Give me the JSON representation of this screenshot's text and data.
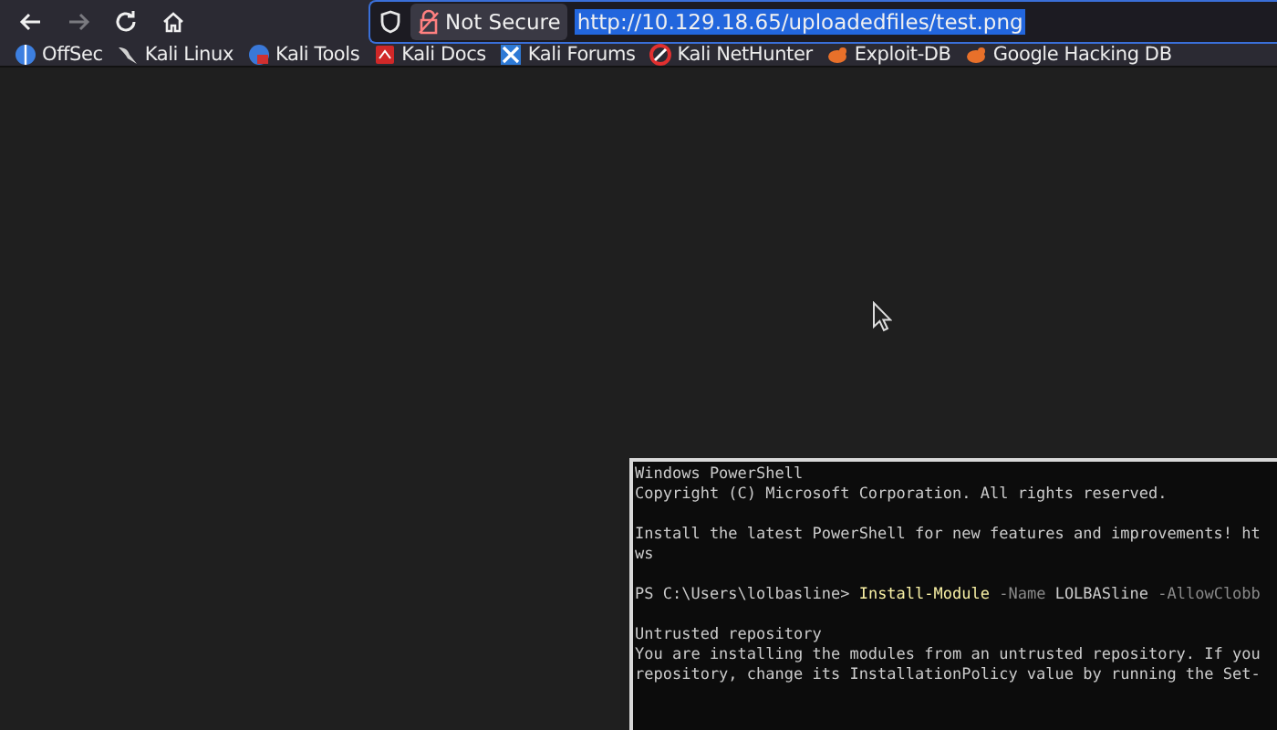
{
  "toolbar": {
    "nav_buttons": [
      {
        "kind": "back",
        "disabled": false
      },
      {
        "kind": "forward",
        "disabled": true
      },
      {
        "kind": "reload",
        "disabled": false
      },
      {
        "kind": "home",
        "disabled": false
      }
    ],
    "address_bar": {
      "security_label": "Not Secure",
      "url": "http://10.129.18.65/uploadedfiles/test.png",
      "selected": true
    }
  },
  "bookmarks": [
    {
      "label": "OffSec"
    },
    {
      "label": "Kali Linux"
    },
    {
      "label": "Kali Tools"
    },
    {
      "label": "Kali Docs"
    },
    {
      "label": "Kali Forums"
    },
    {
      "label": "Kali NetHunter"
    },
    {
      "label": "Exploit-DB"
    },
    {
      "label": "Google Hacking DB"
    }
  ],
  "terminal": {
    "lines": [
      {
        "kind": "text",
        "segments": [
          {
            "kind": "plain",
            "text": "Windows PowerShell"
          }
        ]
      },
      {
        "kind": "text",
        "segments": [
          {
            "kind": "plain",
            "text": "Copyright (C) Microsoft Corporation. All rights reserved."
          }
        ]
      },
      {
        "kind": "blank"
      },
      {
        "kind": "text",
        "segments": [
          {
            "kind": "plain",
            "text": "Install the latest PowerShell for new features and improvements! ht"
          }
        ]
      },
      {
        "kind": "text",
        "segments": [
          {
            "kind": "plain",
            "text": "ws"
          }
        ]
      },
      {
        "kind": "blank"
      },
      {
        "kind": "text",
        "segments": [
          {
            "kind": "plain",
            "text": "PS C:\\Users\\lolbasline> "
          },
          {
            "kind": "command",
            "text": "Install-Module"
          },
          {
            "kind": "parameter",
            "text": " -Name"
          },
          {
            "kind": "plain",
            "text": " LOLBASline"
          },
          {
            "kind": "parameter",
            "text": " -AllowClobb"
          }
        ]
      },
      {
        "kind": "blank"
      },
      {
        "kind": "text",
        "segments": [
          {
            "kind": "plain",
            "text": "Untrusted repository"
          }
        ]
      },
      {
        "kind": "text",
        "segments": [
          {
            "kind": "plain",
            "text": "You are installing the modules from an untrusted repository. If you"
          }
        ]
      },
      {
        "kind": "text",
        "segments": [
          {
            "kind": "plain",
            "text": "repository, change its InstallationPolicy value by running the Set-"
          }
        ]
      }
    ]
  }
}
